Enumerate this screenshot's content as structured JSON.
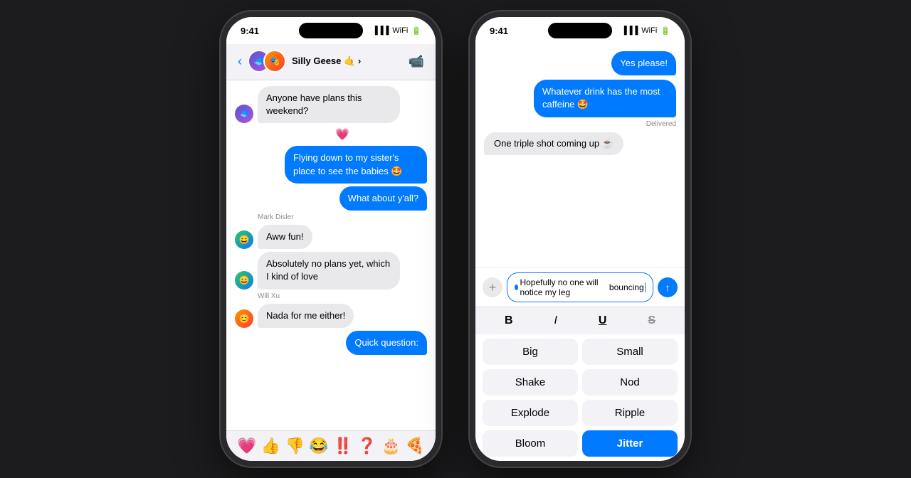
{
  "background": "#1c1c1e",
  "phone1": {
    "status_time": "9:41",
    "header": {
      "chat_name": "Silly Geese",
      "chat_emoji": "🤙"
    },
    "messages": [
      {
        "id": 1,
        "type": "incoming",
        "avatar": "geese",
        "text": "Anyone have plans this weekend?",
        "sender": ""
      },
      {
        "id": 2,
        "type": "reaction",
        "emoji": "💗"
      },
      {
        "id": 3,
        "type": "outgoing",
        "text": "Flying down to my sister's place to see the babies 🤩",
        "sender": ""
      },
      {
        "id": 4,
        "type": "outgoing",
        "text": "What about y'all?",
        "sender": ""
      },
      {
        "id": 5,
        "type": "sender_name",
        "text": "Mark Disler"
      },
      {
        "id": 6,
        "type": "incoming",
        "avatar": "mark",
        "text": "Aww fun!",
        "sender": "Mark Disler"
      },
      {
        "id": 7,
        "type": "incoming",
        "avatar": "mark",
        "text": "Absolutely no plans yet, which I kind of love",
        "sender": ""
      },
      {
        "id": 8,
        "type": "sender_name",
        "text": "Will Xu"
      },
      {
        "id": 9,
        "type": "incoming",
        "avatar": "will",
        "text": "Nada for me either!",
        "sender": "Will Xu"
      },
      {
        "id": 10,
        "type": "outgoing",
        "text": "Quick question:",
        "sender": ""
      }
    ],
    "reactions": [
      "💗",
      "👍",
      "👎",
      "😂",
      "‼️",
      "❓",
      "🎂",
      "🍕"
    ]
  },
  "phone2": {
    "status_time": "9:41",
    "messages": [
      {
        "id": 1,
        "type": "outgoing",
        "text": "Yes please!"
      },
      {
        "id": 2,
        "type": "outgoing",
        "text": "Whatever drink has the most caffeine 🤩"
      },
      {
        "id": 3,
        "type": "delivered",
        "text": "Delivered"
      },
      {
        "id": 4,
        "type": "incoming",
        "text": "One triple shot coming up ☕"
      }
    ],
    "input": {
      "text_line1": "Hopefully no one will notice my leg",
      "text_line2": "bouncing"
    },
    "format_buttons": [
      {
        "label": "B",
        "style": "bold"
      },
      {
        "label": "I",
        "style": "italic"
      },
      {
        "label": "U",
        "style": "underline"
      },
      {
        "label": "S",
        "style": "strikethrough"
      }
    ],
    "effect_buttons": [
      {
        "label": "Big",
        "active": false
      },
      {
        "label": "Small",
        "active": false
      },
      {
        "label": "Shake",
        "active": false
      },
      {
        "label": "Nod",
        "active": false
      },
      {
        "label": "Explode",
        "active": false
      },
      {
        "label": "Ripple",
        "active": false
      },
      {
        "label": "Bloom",
        "active": false
      },
      {
        "label": "Jitter",
        "active": true
      }
    ]
  }
}
